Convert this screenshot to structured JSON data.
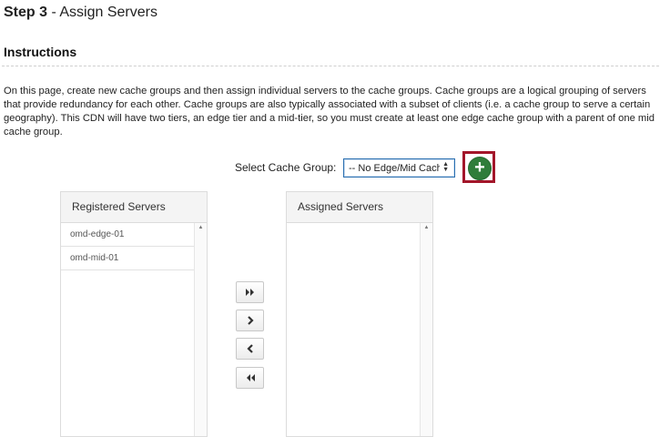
{
  "header": {
    "step_number": "Step 3",
    "step_title": "- Assign Servers"
  },
  "instructions": {
    "heading": "Instructions",
    "text": "On this page, create new cache groups and then assign individual servers to the cache groups. Cache groups are a logical grouping of servers that provide redundancy for each other. Cache groups are also typically associated with a subset of clients (i.e. a cache group to serve a certain geography). This CDN will have two tiers, an edge tier and a mid-tier, so you must create at least one edge cache group with a parent of one mid cache group."
  },
  "cache_group": {
    "label": "Select Cache Group:",
    "selected_value": "-- No Edge/Mid Cach"
  },
  "registered_servers": {
    "title": "Registered Servers",
    "items": [
      {
        "label": "omd-edge-01"
      },
      {
        "label": "omd-mid-01"
      }
    ]
  },
  "assigned_servers": {
    "title": "Assigned Servers",
    "items": []
  },
  "icons": {
    "add": "plus-icon",
    "move_all_right": "double-chevron-right-icon",
    "move_right": "chevron-right-icon",
    "move_left": "chevron-left-icon",
    "move_all_left": "double-chevron-left-icon"
  },
  "colors": {
    "add_button": "#2f7d3a",
    "highlight_border": "#a3162a",
    "select_border": "#2a6fb0"
  }
}
